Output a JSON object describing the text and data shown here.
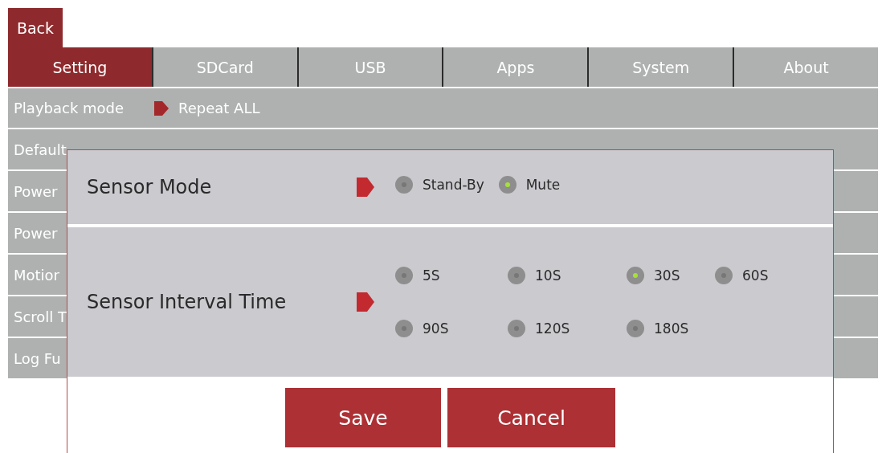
{
  "back_button": "Back",
  "tabs": [
    {
      "label": "Setting",
      "selected": true
    },
    {
      "label": "SDCard",
      "selected": false
    },
    {
      "label": "USB",
      "selected": false
    },
    {
      "label": "Apps",
      "selected": false
    },
    {
      "label": "System",
      "selected": false
    },
    {
      "label": "About",
      "selected": false
    }
  ],
  "settings": [
    {
      "label": "Playback mode",
      "value": "Repeat ALL",
      "marker": true
    },
    {
      "label": "Default"
    },
    {
      "label": "Power"
    },
    {
      "label": "Power"
    },
    {
      "label": "Motior"
    },
    {
      "label": "Scroll T"
    },
    {
      "label": "Log Fu"
    }
  ],
  "dialog": {
    "sections": [
      {
        "title": "Sensor Mode",
        "kind": "inline",
        "options": [
          {
            "label": "Stand-By",
            "selected": false
          },
          {
            "label": "Mute",
            "selected": true
          }
        ]
      },
      {
        "title": "Sensor Interval Time",
        "kind": "grid",
        "options": [
          {
            "label": "5S",
            "selected": false
          },
          {
            "label": "10S",
            "selected": false
          },
          {
            "label": "30S",
            "selected": true
          },
          {
            "label": "60S",
            "selected": false
          },
          {
            "label": "90S",
            "selected": false
          },
          {
            "label": "120S",
            "selected": false
          },
          {
            "label": "180S",
            "selected": false
          }
        ]
      }
    ],
    "buttons": [
      "Save",
      "Cancel"
    ]
  }
}
